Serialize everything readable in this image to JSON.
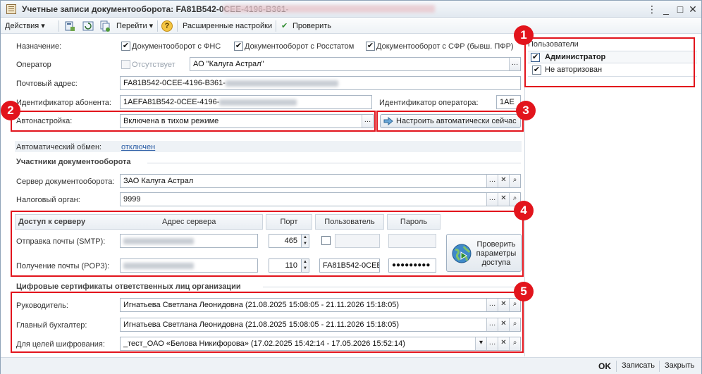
{
  "window": {
    "title": "Учетные записи документооборота: FA81B542-0CEE-4196-B361-"
  },
  "toolbar": {
    "actions": "Действия",
    "goto": "Перейти",
    "help": "?",
    "advanced": "Расширенные настройки",
    "check": "Проверить"
  },
  "form": {
    "purpose_label": "Назначение:",
    "purpose_fns": "Документооборот с ФНС",
    "purpose_rosstat": "Документооборот с Росстатом",
    "purpose_sfr": "Документооборот с СФР (бывш. ПФР)",
    "operator_label": "Оператор",
    "operator_absent": "Отсутствует",
    "operator_value": "АО \"Калуга Астрал\"",
    "mail_label": "Почтовый адрес:",
    "mail_value": "FA81B542-0CEE-4196-B361-",
    "subscriber_id_label": "Идентификатор абонента:",
    "subscriber_id_value": "1AEFA81B542-0CEE-4196-",
    "operator_id_label": "Идентификатор оператора:",
    "operator_id_value": "1AE",
    "autoconfig_label": "Автонастройка:",
    "autoconfig_value": "Включена в тихом режиме",
    "autoconfig_button": "Настроить автоматически сейчас",
    "auto_exchange_label": "Автоматический обмен:",
    "auto_exchange_value": "отключен"
  },
  "participants": {
    "section": "Участники документооборота",
    "server_label": "Сервер документооборота:",
    "server_value": "ЗАО Калуга Астрал",
    "tax_label": "Налоговый орган:",
    "tax_value": "9999"
  },
  "server_access": {
    "section": "Доступ к серверу",
    "col_address": "Адрес сервера",
    "col_port": "Порт",
    "col_user": "Пользователь",
    "col_password": "Пароль",
    "smtp_label": "Отправка почты (SMTP):",
    "smtp_port": "465",
    "pop3_label": "Получение почты (POP3):",
    "pop3_port": "110",
    "pop3_user": "FA81B542-0CEE",
    "pop3_password": "●●●●●●●●●",
    "check_button": "Проверить параметры доступа"
  },
  "certificates": {
    "section": "Цифровые сертификаты ответственных лиц организации",
    "head_label": "Руководитель:",
    "head_value": "Игнатьева Светлана Леонидовна (21.08.2025 15:08:05 - 21.11.2026 15:18:05)",
    "accountant_label": "Главный бухгалтер:",
    "accountant_value": "Игнатьева Светлана Леонидовна (21.08.2025 15:08:05 - 21.11.2026 15:18:05)",
    "encryption_label": "Для целей шифрования:",
    "encryption_value": "_тест_ОАО «Белова Никифорова» (17.02.2025 15:42:14 - 17.05.2026 15:52:14)"
  },
  "users_panel": {
    "title": "Пользователи",
    "items": [
      {
        "label": "Администратор",
        "checked": true,
        "bold": true
      },
      {
        "label": "Не авторизован",
        "checked": true,
        "bold": false
      }
    ]
  },
  "callouts": [
    "1",
    "2",
    "3",
    "4",
    "5"
  ],
  "footer": {
    "ok": "OK",
    "save": "Записать",
    "close": "Закрыть"
  },
  "colors": {
    "highlight": "#e2141c",
    "link": "#2d5fa6"
  }
}
